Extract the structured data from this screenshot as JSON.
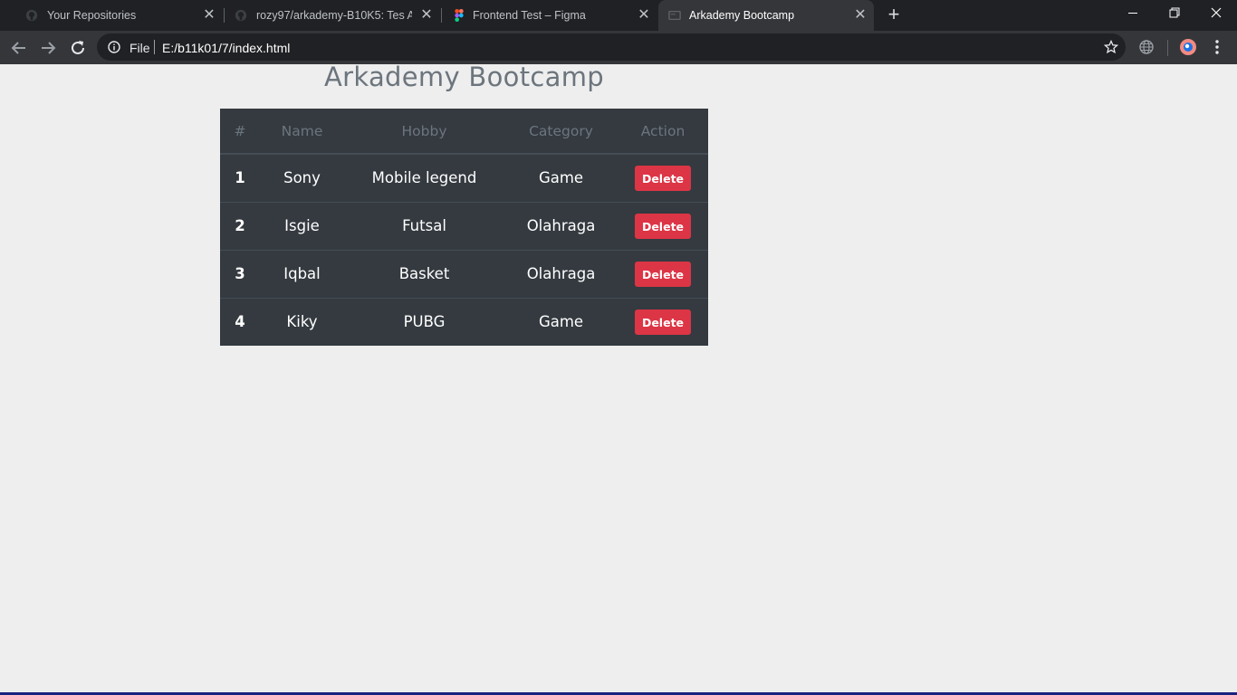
{
  "browser": {
    "tabs": [
      {
        "title": "Your Repositories",
        "icon": "github-icon"
      },
      {
        "title": "rozy97/arkademy-B10K5: Tes Arkademy",
        "icon": "github-icon"
      },
      {
        "title": "Frontend Test – Figma",
        "icon": "figma-icon"
      },
      {
        "title": "Arkademy Bootcamp",
        "icon": "page-icon",
        "active": true
      }
    ],
    "address": {
      "scheme_label": "File",
      "url": "E:/b11k01/7/index.html"
    }
  },
  "page": {
    "title": "Arkademy Bootcamp",
    "table": {
      "headers": [
        "#",
        "Name",
        "Hobby",
        "Category",
        "Action"
      ],
      "rows": [
        {
          "num": "1",
          "name": "Sony",
          "hobby": "Mobile legend",
          "category": "Game",
          "action": "Delete"
        },
        {
          "num": "2",
          "name": "Isgie",
          "hobby": "Futsal",
          "category": "Olahraga",
          "action": "Delete"
        },
        {
          "num": "3",
          "name": "Iqbal",
          "hobby": "Basket",
          "category": "Olahraga",
          "action": "Delete"
        },
        {
          "num": "4",
          "name": "Kiky",
          "hobby": "PUBG",
          "category": "Game",
          "action": "Delete"
        }
      ]
    }
  },
  "colors": {
    "table_bg": "#343a40",
    "header_text": "#6c757d",
    "danger": "#dc3545",
    "page_bg": "#eeeeee"
  }
}
